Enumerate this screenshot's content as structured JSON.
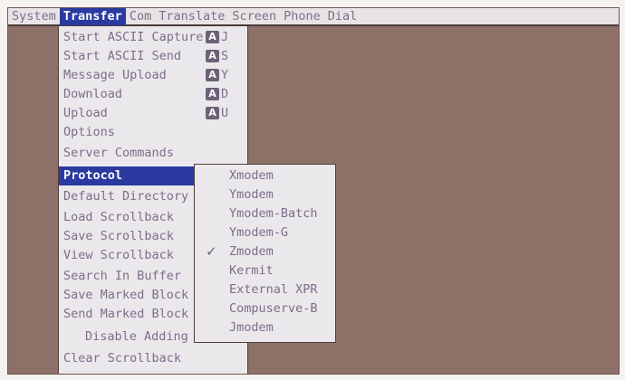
{
  "menubar": [
    "System",
    "Transfer",
    "Com",
    "Translate",
    "Screen",
    "Phone",
    "Dial"
  ],
  "transfer_menu": {
    "items": [
      {
        "label": "Start ASCII Capture",
        "shortcut": "J"
      },
      {
        "label": "Start ASCII Send",
        "shortcut": "S"
      },
      {
        "label": "Message Upload",
        "shortcut": "Y"
      },
      {
        "label": "Download",
        "shortcut": "D"
      },
      {
        "label": "Upload",
        "shortcut": "U"
      },
      {
        "label": "Options"
      },
      {
        "label": "Server Commands"
      },
      {
        "label": "Protocol"
      },
      {
        "label": "Default Directory"
      },
      {
        "label": "Load Scrollback"
      },
      {
        "label": "Save Scrollback"
      },
      {
        "label": "View Scrollback"
      },
      {
        "label": "Search In Buffer"
      },
      {
        "label": "Save Marked Block"
      },
      {
        "label": "Send Marked Block"
      },
      {
        "label": "Disable Adding"
      },
      {
        "label": "Clear Scrollback"
      }
    ],
    "amiga_key_glyph": "A"
  },
  "protocol_submenu": {
    "items": [
      "Xmodem",
      "Ymodem",
      "Ymodem-Batch",
      "Ymodem-G",
      "Zmodem",
      "Kermit",
      "External XPR",
      "Compuserve-B",
      "Jmodem"
    ],
    "checked": "Zmodem",
    "check_glyph": "✓"
  },
  "colors": {
    "background": "#8d7068",
    "menu_bg": "#ebe8ec",
    "highlight": "#2b3aa0",
    "menu_text": "#7a6f88"
  }
}
